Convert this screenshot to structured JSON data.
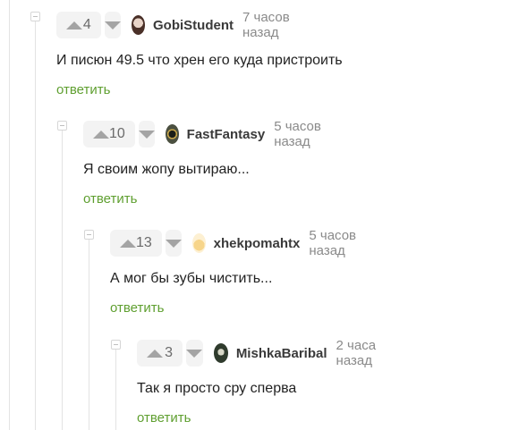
{
  "comments": [
    {
      "rating": "4",
      "username": "GobiStudent",
      "time": "7 часов назад",
      "text": "И писюн 49.5 что хрен его куда пристроить",
      "reply_label": "ответить",
      "avatar_color": "#6b4a3d"
    },
    {
      "rating": "10",
      "username": "FastFantasy",
      "time": "5 часов назад",
      "text": "Я своим жопу вытираю...",
      "reply_label": "ответить",
      "avatar_color": "#3b3f35"
    },
    {
      "rating": "13",
      "username": "xhekpomahtx",
      "time": "5 часов назад",
      "text": "А мог бы зубы чистить...",
      "reply_label": "ответить",
      "avatar_color": "#f2c46b"
    },
    {
      "rating": "3",
      "username": "MishkaBaribal",
      "time": "2 часа назад",
      "text": "Так я просто сру сперва",
      "reply_label": "ответить",
      "avatar_color": "#2f3b2d"
    }
  ],
  "colors": {
    "accent": "#5f9f30",
    "vote_bg": "#f3f3f3",
    "thread_line": "#e3e3e3"
  },
  "icons": {
    "upvote": "up-arrow-icon",
    "downvote": "down-arrow-icon",
    "collapse": "collapse-icon"
  }
}
